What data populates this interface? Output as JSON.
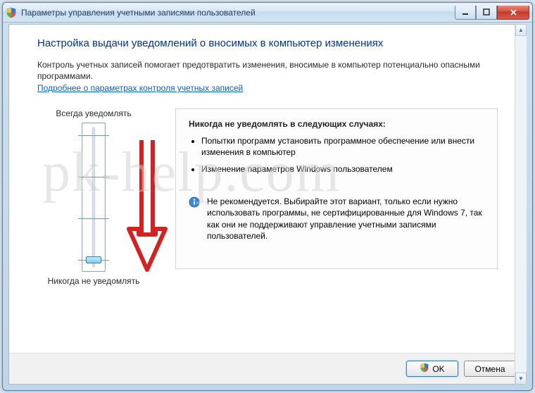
{
  "window": {
    "title": "Параметры управления учетными записями пользователей"
  },
  "page": {
    "title": "Настройка выдачи уведомлений о вносимых в компьютер изменениях",
    "intro": "Контроль учетных записей помогает предотвратить изменения, вносимые в компьютер потенциально опасными программами.",
    "help_link": "Подробнее о параметрах контроля учетных записей"
  },
  "slider": {
    "top_label": "Всегда уведомлять",
    "bottom_label": "Никогда не уведомлять",
    "level": 0,
    "levels": 4
  },
  "description": {
    "heading": "Никогда не уведомлять в следующих случаях:",
    "bullets": [
      "Попытки программ установить программное обеспечение или внести изменения в компьютер",
      "Изменение параметров Windows пользователем"
    ],
    "recommendation": "Не рекомендуется. Выбирайте этот вариант, только если нужно использовать программы, не сертифицированные для Windows 7, так как они не поддерживают управление учетными записями пользователей."
  },
  "footer": {
    "ok_label": "OK",
    "cancel_label": "Отмена"
  },
  "watermark": "pk-help.com"
}
